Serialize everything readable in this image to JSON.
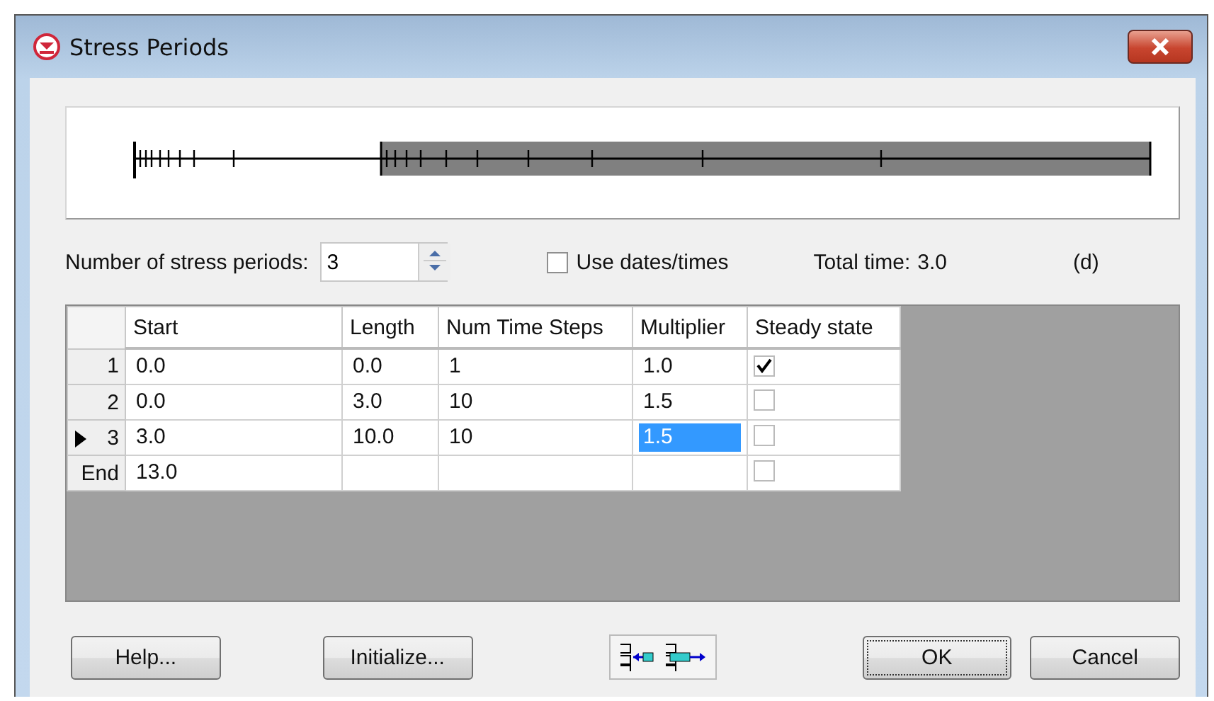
{
  "window": {
    "title": "Stress Periods"
  },
  "stress_periods": {
    "label": "Number of stress periods:",
    "value": "3"
  },
  "use_dates": {
    "label": "Use dates/times",
    "checked": false
  },
  "total_time": {
    "label": "Total time:",
    "value": "3.0",
    "unit": "(d)"
  },
  "table": {
    "columns": [
      "Start",
      "Length",
      "Num Time Steps",
      "Multiplier",
      "Steady state"
    ],
    "rows": [
      {
        "header": "1",
        "selected": false,
        "steady": true,
        "cells": [
          {
            "text": "0.0",
            "selected": false
          },
          {
            "text": "0.0",
            "selected": false
          },
          {
            "text": "1",
            "selected": false
          },
          {
            "text": "1.0",
            "selected": false
          }
        ]
      },
      {
        "header": "2",
        "selected": false,
        "steady": false,
        "cells": [
          {
            "text": "0.0",
            "selected": false
          },
          {
            "text": "3.0",
            "selected": false
          },
          {
            "text": "10",
            "selected": false
          },
          {
            "text": "1.5",
            "selected": false
          }
        ]
      },
      {
        "header": "3",
        "selected": true,
        "steady": false,
        "cells": [
          {
            "text": "3.0",
            "selected": false
          },
          {
            "text": "10.0",
            "selected": false
          },
          {
            "text": "10",
            "selected": false
          },
          {
            "text": "1.5",
            "selected": true
          }
        ]
      },
      {
        "header": "End",
        "selected": false,
        "steady": false,
        "cells": [
          {
            "text": "13.0",
            "selected": false
          }
        ]
      }
    ]
  },
  "buttons": {
    "help": "Help...",
    "initialize": "Initialize...",
    "ok": "OK",
    "cancel": "Cancel"
  }
}
